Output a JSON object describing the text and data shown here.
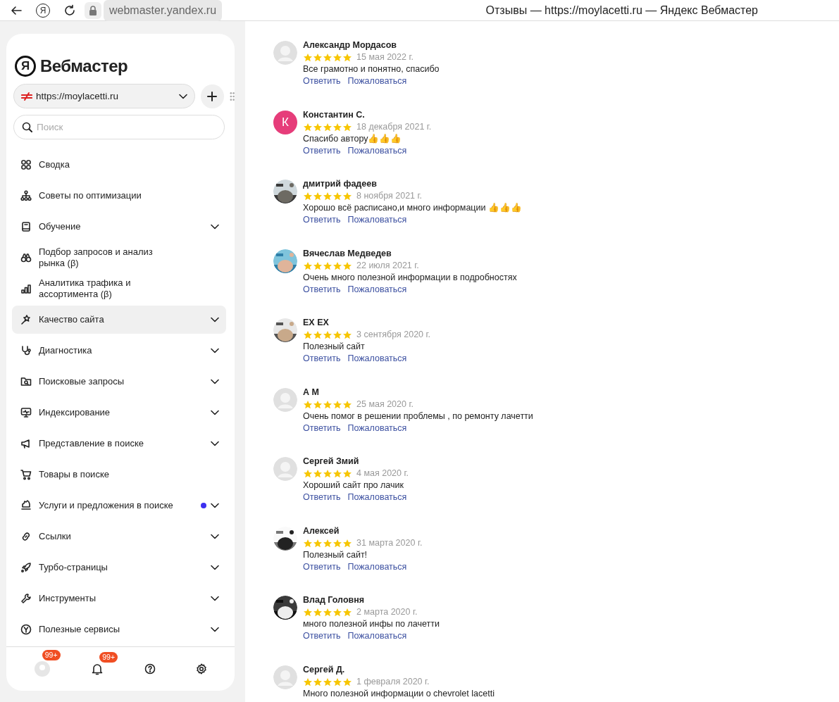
{
  "browser": {
    "yandex_button": "Я",
    "address": "webmaster.yandex.ru",
    "title": "Отзывы — https://moylacetti.ru — Яндекс Вебмастер"
  },
  "sidebar": {
    "logo": {
      "mark": "Я",
      "text": "Вебмастер"
    },
    "site_select": {
      "value": "https://moylacetti.ru"
    },
    "search": {
      "placeholder": "Поиск"
    },
    "items": [
      {
        "label": "Сводка",
        "expandable": false,
        "selected": false,
        "new_dot": false
      },
      {
        "label": "Советы по оптимизации",
        "expandable": false,
        "selected": false,
        "new_dot": false
      },
      {
        "label": "Обучение",
        "expandable": true,
        "selected": false,
        "new_dot": false
      },
      {
        "label": "Подбор запросов и анализ рынка (β)",
        "expandable": false,
        "selected": false,
        "new_dot": false
      },
      {
        "label": "Аналитика трафика и ассортимента (β)",
        "expandable": false,
        "selected": false,
        "new_dot": false
      },
      {
        "label": "Качество сайта",
        "expandable": true,
        "selected": true,
        "new_dot": false
      },
      {
        "label": "Диагностика",
        "expandable": true,
        "selected": false,
        "new_dot": false
      },
      {
        "label": "Поисковые запросы",
        "expandable": true,
        "selected": false,
        "new_dot": false
      },
      {
        "label": "Индексирование",
        "expandable": true,
        "selected": false,
        "new_dot": false
      },
      {
        "label": "Представление в поиске",
        "expandable": true,
        "selected": false,
        "new_dot": false
      },
      {
        "label": "Товары в поиске",
        "expandable": false,
        "selected": false,
        "new_dot": false
      },
      {
        "label": "Услуги и предложения в поиске",
        "expandable": true,
        "selected": false,
        "new_dot": true
      },
      {
        "label": "Ссылки",
        "expandable": true,
        "selected": false,
        "new_dot": false
      },
      {
        "label": "Турбо-страницы",
        "expandable": true,
        "selected": false,
        "new_dot": false
      },
      {
        "label": "Инструменты",
        "expandable": true,
        "selected": false,
        "new_dot": false
      },
      {
        "label": "Полезные сервисы",
        "expandable": true,
        "selected": false,
        "new_dot": false
      }
    ],
    "footer": {
      "profile_badge": "99+",
      "notifications_badge": "99+"
    }
  },
  "reviews": [
    {
      "author": "Александр Мордасов",
      "avatar": {
        "kind": "placeholder"
      },
      "stars": 5,
      "date": "15 мая 2022 г.",
      "text": "Все грамотно и понятно, спасибо",
      "actions": [
        "Ответить",
        "Пожаловаться"
      ]
    },
    {
      "author": "Константин С.",
      "avatar": {
        "kind": "letter",
        "letter": "К"
      },
      "stars": 5,
      "date": "18 декабря 2021 г.",
      "text": "Спасибо автору👍👍👍",
      "actions": [
        "Ответить",
        "Пожаловаться"
      ]
    },
    {
      "author": "дмитрий фадеев",
      "stars": 5,
      "date": "8 ноября 2021 г.",
      "text": "Хорошо всё расписано,и много информации 👍👍👍",
      "actions": [
        "Ответить",
        "Пожаловаться"
      ]
    },
    {
      "author": "Вячеслав Медведев",
      "stars": 5,
      "date": "22 июля 2021 г.",
      "text": "Очень много полезной информации в подробностях",
      "actions": [
        "Ответить",
        "Пожаловаться"
      ]
    },
    {
      "author": "EX EX",
      "stars": 5,
      "date": "3 сентября 2020 г.",
      "text": "Полезный сайт",
      "actions": [
        "Ответить",
        "Пожаловаться"
      ]
    },
    {
      "author": "А М",
      "avatar": {
        "kind": "placeholder"
      },
      "stars": 5,
      "date": "25 мая 2020 г.",
      "text": "Очень помог в решении проблемы , по ремонту лачетти",
      "actions": [
        "Ответить",
        "Пожаловаться"
      ]
    },
    {
      "author": "Сергей Змий",
      "avatar": {
        "kind": "placeholder"
      },
      "stars": 5,
      "date": "4 мая 2020 г.",
      "text": "Хороший сайт про лачик",
      "actions": [
        "Ответить",
        "Пожаловаться"
      ]
    },
    {
      "author": "Алексей",
      "stars": 5,
      "date": "31 марта 2020 г.",
      "text": "Полезный сайт!",
      "actions": [
        "Ответить",
        "Пожаловаться"
      ]
    },
    {
      "author": "Влад Головня",
      "stars": 5,
      "date": "2 марта 2020 г.",
      "text": "много полезной инфы по лачетти",
      "actions": [
        "Ответить",
        "Пожаловаться"
      ]
    },
    {
      "author": "Сергей Д.",
      "avatar": {
        "kind": "placeholder"
      },
      "stars": 5,
      "date": "1 февраля 2020 г.",
      "text": "Много полезной информации о chevrolet lacetti"
    }
  ]
}
